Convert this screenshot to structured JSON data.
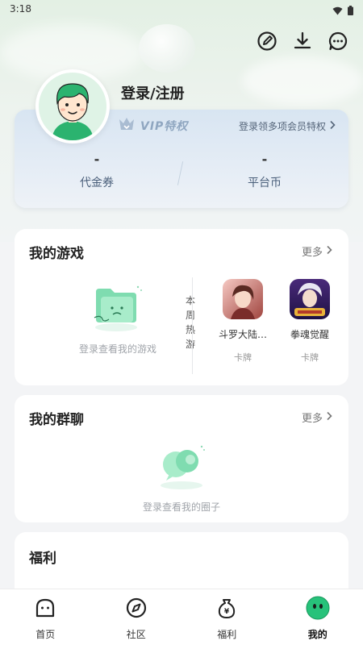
{
  "status_bar": {
    "time": "3:18"
  },
  "header": {
    "login_label": "登录/注册",
    "actions": [
      "edit-icon",
      "download-icon",
      "message-icon"
    ]
  },
  "vip": {
    "badge_text": "VIP特权",
    "link_text": "登录领多项会员特权",
    "stats": [
      {
        "value": "-",
        "label": "代金券"
      },
      {
        "value": "-",
        "label": "平台币"
      }
    ]
  },
  "my_games": {
    "title": "我的游戏",
    "more": "更多",
    "empty_text": "登录查看我的游戏",
    "weekly_hot": [
      "本",
      "周",
      "热",
      "游"
    ],
    "hot_games": [
      {
        "name": "斗罗大陆…",
        "tag": "卡牌",
        "icon": "game-icon-douluo"
      },
      {
        "name": "拳魂觉醒",
        "tag": "卡牌",
        "icon": "game-icon-quanhun"
      }
    ]
  },
  "my_groups": {
    "title": "我的群聊",
    "more": "更多",
    "empty_text": "登录查看我的圈子"
  },
  "welfare": {
    "title": "福利"
  },
  "tabbar": {
    "items": [
      {
        "label": "首页",
        "icon": "home-icon"
      },
      {
        "label": "社区",
        "icon": "compass-icon"
      },
      {
        "label": "福利",
        "icon": "money-bag-icon"
      },
      {
        "label": "我的",
        "icon": "me-icon"
      }
    ],
    "active_index": 3
  },
  "colors": {
    "accent": "#27c27a",
    "vip_text": "#8fa6c0"
  }
}
